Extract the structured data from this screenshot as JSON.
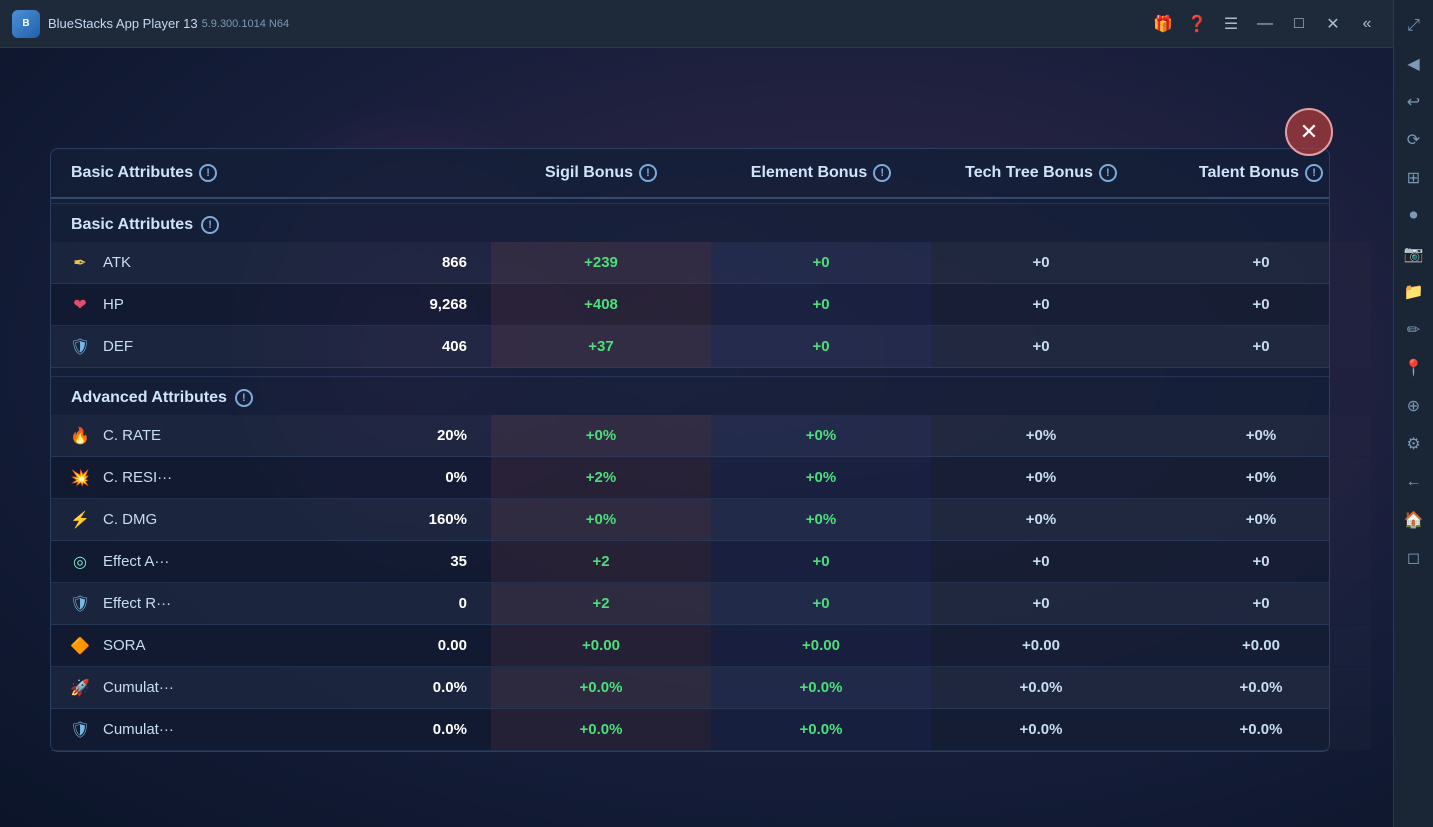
{
  "titlebar": {
    "logo": "B",
    "app_name": "BlueStacks App Player 13",
    "subtitle": "5.9.300.1014  N64",
    "controls": {
      "gift_label": "🎁",
      "help_label": "?",
      "menu_label": "≡",
      "minimize_label": "—",
      "maximize_label": "□",
      "close_label": "✕",
      "back_label": "❮❮"
    }
  },
  "sidebar_icons": [
    "⤢",
    "◀",
    "↩",
    "⟳",
    "⊞",
    "✎",
    "◎",
    "⊟",
    "⊕",
    "⚙",
    "←"
  ],
  "game_close": "✕",
  "columns": {
    "basic": "Basic Attributes",
    "sigil": "Sigil Bonus",
    "element": "Element Bonus",
    "tech": "Tech Tree Bonus",
    "talent": "Talent Bonus"
  },
  "basic_section_label": "Basic Attributes",
  "advanced_section_label": "Advanced Attributes",
  "basic_rows": [
    {
      "icon": "✏",
      "name": "ATK",
      "value": "866",
      "sigil": "+239",
      "element": "+0",
      "tech": "+0",
      "talent": "+0",
      "sigil_green": true,
      "element_green": true
    },
    {
      "icon": "❤",
      "name": "HP",
      "value": "9,268",
      "sigil": "+408",
      "element": "+0",
      "tech": "+0",
      "talent": "+0",
      "sigil_green": true,
      "element_green": true
    },
    {
      "icon": "🛡",
      "name": "DEF",
      "value": "406",
      "sigil": "+37",
      "element": "+0",
      "tech": "+0",
      "talent": "+0",
      "sigil_green": true,
      "element_green": true
    }
  ],
  "advanced_rows": [
    {
      "icon": "🔥",
      "name": "C. RATE",
      "value": "20%",
      "sigil": "+0%",
      "element": "+0%",
      "tech": "+0%",
      "talent": "+0%",
      "sigil_green": true,
      "element_green": true
    },
    {
      "icon": "💥",
      "name": "C. RESI···",
      "value": "0%",
      "sigil": "+2%",
      "element": "+0%",
      "tech": "+0%",
      "talent": "+0%",
      "sigil_green": true,
      "element_green": true
    },
    {
      "icon": "⚡",
      "name": "C. DMG",
      "value": "160%",
      "sigil": "+0%",
      "element": "+0%",
      "tech": "+0%",
      "talent": "+0%",
      "sigil_green": true,
      "element_green": true
    },
    {
      "icon": "🎯",
      "name": "Effect A···",
      "value": "35",
      "sigil": "+2",
      "element": "+0",
      "tech": "+0",
      "talent": "+0",
      "sigil_green": true,
      "element_green": true
    },
    {
      "icon": "🛡",
      "name": "Effect R···",
      "value": "0",
      "sigil": "+2",
      "element": "+0",
      "tech": "+0",
      "talent": "+0",
      "sigil_green": true,
      "element_green": true
    },
    {
      "icon": "🔵",
      "name": "SORA",
      "value": "0.00",
      "sigil": "+0.00",
      "element": "+0.00",
      "tech": "+0.00",
      "talent": "+0.00",
      "sigil_green": true,
      "element_green": true
    },
    {
      "icon": "🚀",
      "name": "Cumulat···",
      "value": "0.0%",
      "sigil": "+0.0%",
      "element": "+0.0%",
      "tech": "+0.0%",
      "talent": "+0.0%",
      "sigil_green": true,
      "element_green": true
    },
    {
      "icon": "🛡",
      "name": "Cumulat···",
      "value": "0.0%",
      "sigil": "+0.0%",
      "element": "+0.0%",
      "tech": "+0.0%",
      "talent": "+0.0%",
      "sigil_green": true,
      "element_green": true
    }
  ]
}
